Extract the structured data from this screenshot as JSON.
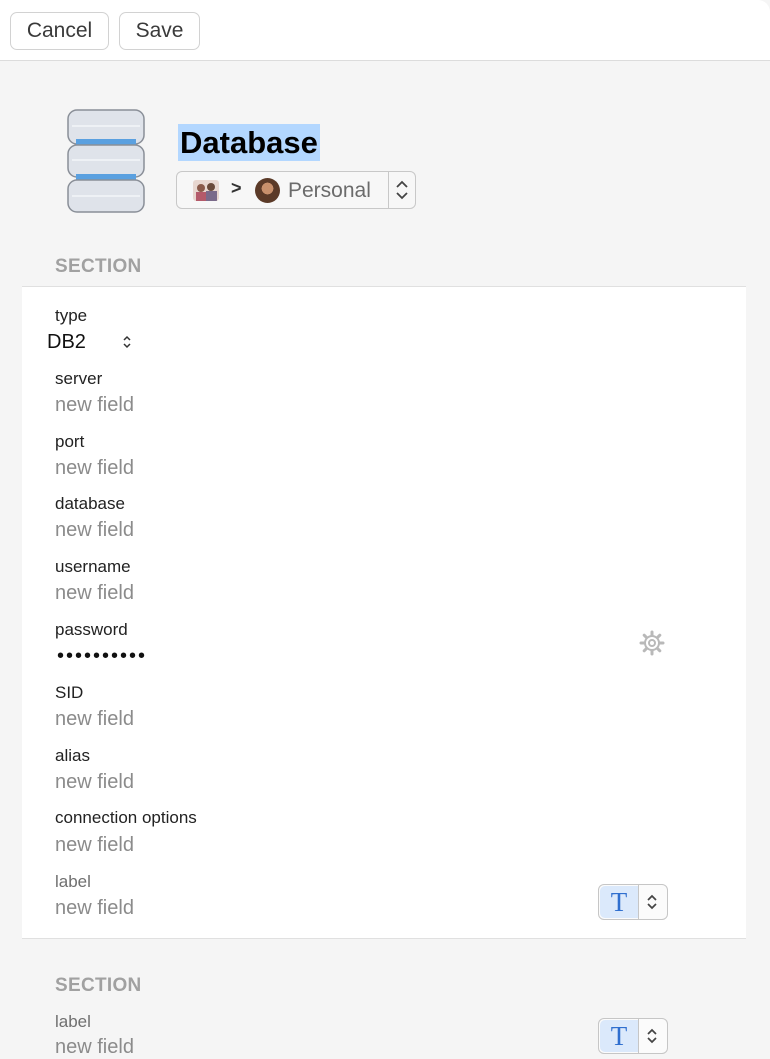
{
  "toolbar": {
    "cancel_label": "Cancel",
    "save_label": "Save"
  },
  "header": {
    "icon": "database-icon",
    "title": "Database",
    "vault": {
      "separator": ">",
      "name": "Personal"
    }
  },
  "sections": [
    {
      "header": "SECTION",
      "fields": {
        "type": {
          "label": "type",
          "value": "DB2"
        },
        "server": {
          "label": "server",
          "placeholder": "new field"
        },
        "port": {
          "label": "port",
          "placeholder": "new field"
        },
        "database": {
          "label": "database",
          "placeholder": "new field"
        },
        "username": {
          "label": "username",
          "placeholder": "new field"
        },
        "password": {
          "label": "password",
          "value": "••••••••••"
        },
        "sid": {
          "label": "SID",
          "placeholder": "new field"
        },
        "alias": {
          "label": "alias",
          "placeholder": "new field"
        },
        "connection_options": {
          "label": "connection options",
          "placeholder": "new field"
        },
        "custom": {
          "label": "label",
          "placeholder": "new field",
          "type_button": "T"
        }
      }
    },
    {
      "header": "SECTION",
      "fields": {
        "custom": {
          "label": "label",
          "placeholder": "new field",
          "type_button": "T"
        }
      }
    }
  ],
  "colors": {
    "selection_highlight": "#b3d7ff",
    "type_button_accent": "#2f6fcf"
  }
}
